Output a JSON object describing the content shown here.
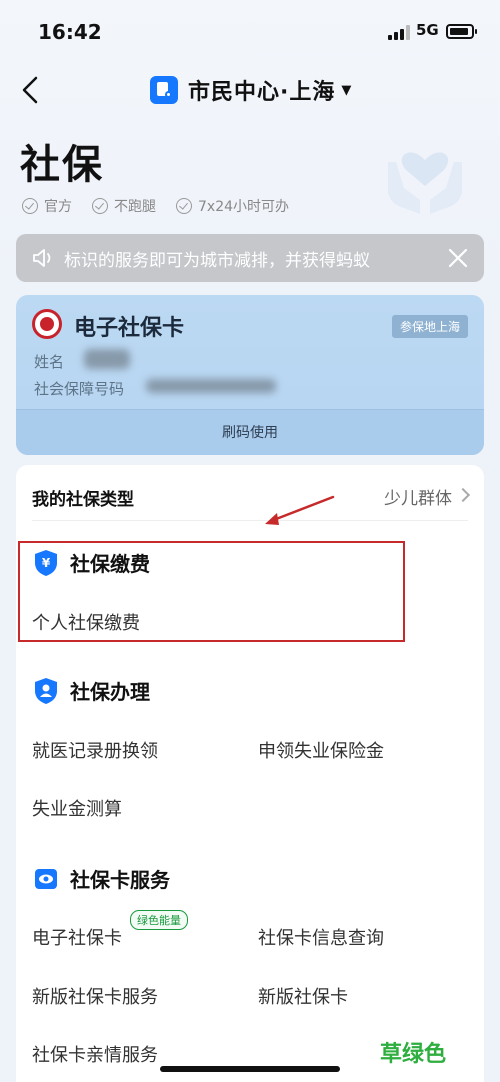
{
  "status_bar": {
    "time": "16:42",
    "network": "5G"
  },
  "nav": {
    "title": "市民中心·上海"
  },
  "page": {
    "title": "社保",
    "tags": [
      "官方",
      "不跑腿",
      "7x24小时可办"
    ]
  },
  "notice": {
    "text": "标识的服务即可为城市减排，并获得蚂蚁"
  },
  "card": {
    "title": "电子社保卡",
    "badge": "参保地上海",
    "name_label": "姓名",
    "id_label": "社会保障号码",
    "action": "刷码使用"
  },
  "insurance_type": {
    "label": "我的社保类型",
    "value": "少儿群体"
  },
  "sections": [
    {
      "title": "社保缴费",
      "items": [
        "个人社保缴费"
      ]
    },
    {
      "title": "社保办理",
      "items": [
        "就医记录册换领",
        "申领失业保险金",
        "失业金测算"
      ]
    },
    {
      "title": "社保卡服务",
      "items": [
        "电子社保卡",
        "社保卡信息查询",
        "新版社保卡服务",
        "新版社保卡",
        "社保卡亲情服务"
      ],
      "badge": "绿色能量"
    }
  ],
  "watermark": {
    "text": "草绿色"
  },
  "colors": {
    "accent": "#1677ff",
    "highlight": "#c62a2a",
    "green": "#1a9a3f"
  }
}
